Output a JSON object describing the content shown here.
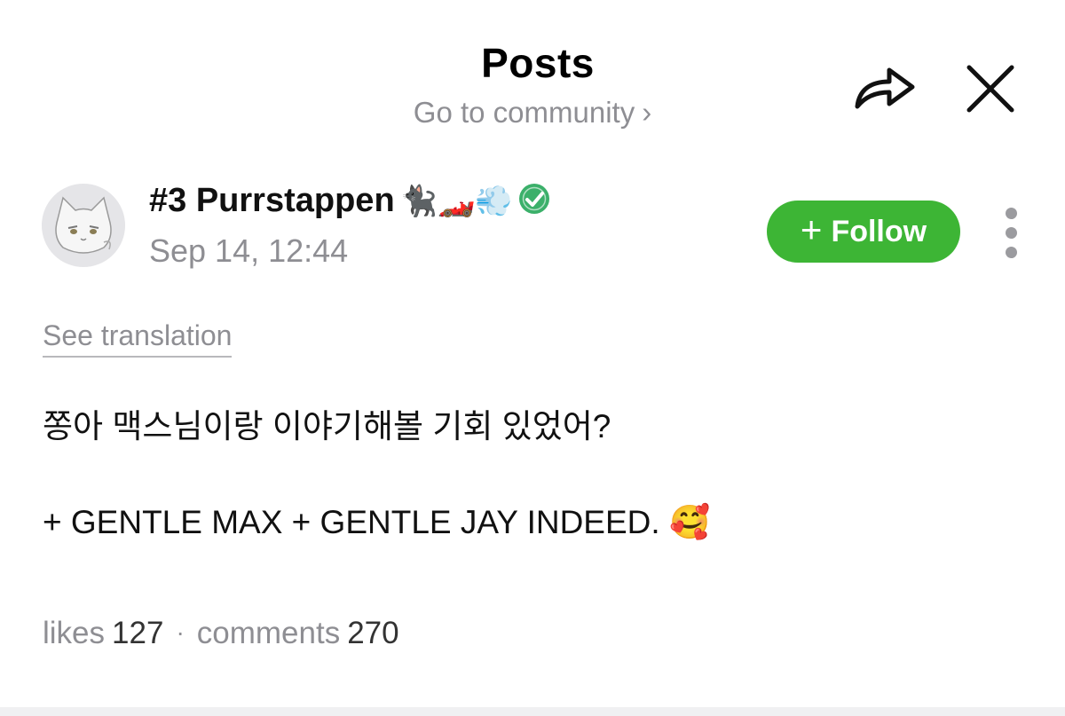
{
  "header": {
    "title": "Posts",
    "community_link": "Go to community",
    "community_chevron": "›",
    "share_icon": "share-arrow-icon",
    "close_icon": "close-icon"
  },
  "post": {
    "author": {
      "name": "#3 Purrstappen",
      "name_emoji": "🐈‍⬛🏎️💨",
      "verified": true,
      "avatar": "cat-sketch-avatar"
    },
    "timestamp": "Sep 14, 12:44",
    "follow_label": "Follow",
    "follow_plus": "+",
    "see_translation": "See translation",
    "body_line1": "쫑아 맥스님이랑 이야기해볼 기회 있었어?",
    "body_line2": "+ GENTLE MAX + GENTLE JAY INDEED. 🥰",
    "stats": {
      "likes_label": "likes",
      "likes_count": "127",
      "separator": "·",
      "comments_label": "comments",
      "comments_count": "270"
    }
  },
  "colors": {
    "follow_green": "#3db535",
    "muted_gray": "#8e8e93",
    "verified_green": "#3bb06a"
  }
}
